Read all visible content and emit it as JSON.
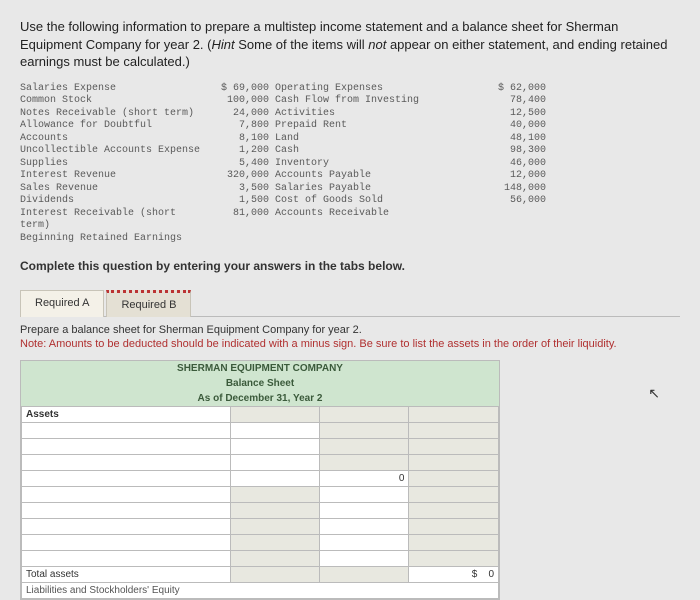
{
  "instructions": {
    "main": "Use the following information to prepare a multistep income statement and a balance sheet for Sherman Equipment Company for year 2. (",
    "hint_label": "Hint",
    "hint_text": " Some of the items will ",
    "not_word": "not",
    "hint_text2": " appear on either statement, and ending retained earnings must be calculated.)"
  },
  "accounts": {
    "left_labels": [
      "Salaries Expense",
      "Common Stock",
      "Notes Receivable (short term)",
      "Allowance for Doubtful Accounts",
      "Uncollectible Accounts Expense",
      "Supplies",
      "Interest Revenue",
      "Sales Revenue",
      "Dividends",
      "Interest Receivable (short term)",
      "Beginning Retained Earnings"
    ],
    "left_amounts": [
      "$ 69,000",
      "100,000",
      "24,000",
      "7,800",
      "8,100",
      "1,200",
      "5,400",
      "320,000",
      "3,500",
      "1,500",
      "81,000"
    ],
    "mid_labels": [
      "Operating Expenses",
      "Cash Flow from Investing Activities",
      "Prepaid Rent",
      "Land",
      "Cash",
      "Inventory",
      "Accounts Payable",
      "Salaries Payable",
      "Cost of Goods Sold",
      "Accounts Receivable",
      ""
    ],
    "mid_amounts": [
      "$ 62,000",
      "78,400",
      "12,500",
      "40,000",
      "48,100",
      "98,300",
      "46,000",
      "12,000",
      "148,000",
      "56,000",
      ""
    ]
  },
  "complete_bar": "Complete this question by entering your answers in the tabs below.",
  "tabs": {
    "a": "Required A",
    "b": "Required B"
  },
  "prepare": {
    "line1": "Prepare a balance sheet for Sherman Equipment Company for year 2.",
    "line2": "Note: Amounts to be deducted should be indicated with a minus sign. Be sure to list the assets in the order of their liquidity."
  },
  "sheet": {
    "h1": "SHERMAN EQUIPMENT COMPANY",
    "h2": "Balance Sheet",
    "h3": "As of December 31, Year 2",
    "assets_hdr": "Assets",
    "total_assets": "Total assets",
    "liab_hdr": "Liabilities and Stockholders' Equity",
    "zero": "0",
    "dollar": "$"
  }
}
